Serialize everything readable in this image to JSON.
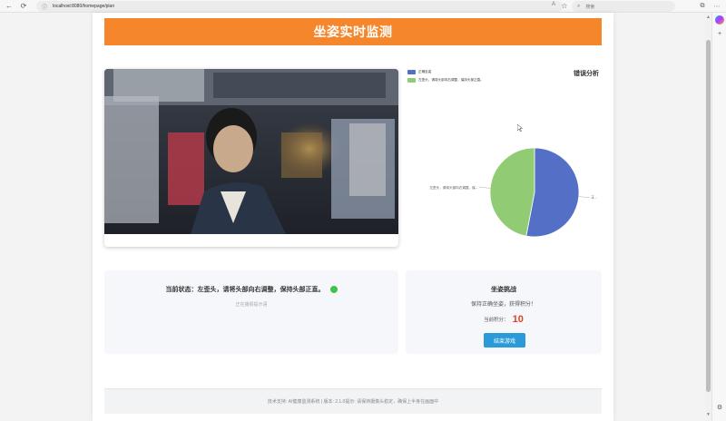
{
  "browser": {
    "url": "localhost:8080/homepage/plan",
    "search_placeholder": "搜索",
    "icons": [
      "back-icon",
      "refresh-icon",
      "info-icon",
      "read-aloud-icon",
      "favorite-icon",
      "search-icon",
      "extensions-icon",
      "more-icon",
      "copilot-icon",
      "add-icon",
      "settings-icon"
    ]
  },
  "header": {
    "title": "坐姿实时监测"
  },
  "chart": {
    "title": "错误分析",
    "chart_data": {
      "type": "pie",
      "title": "错误分析",
      "legend_position": "top-left",
      "series": [
        {
          "name": "正确坐姿",
          "value": 53,
          "color": "#5470c6"
        },
        {
          "name": "左歪头，请将头部向右调整，保持头部正直。",
          "value": 47,
          "color": "#91cc75"
        }
      ],
      "labels": [
        {
          "text": "正...",
          "side": "right"
        },
        {
          "text": "左歪头，请将头部向右调整，保...",
          "side": "left"
        }
      ]
    }
  },
  "status": {
    "label": "当前状态：左歪头，请将头部向右调整，保持头部正直。",
    "sub": "正在播报提示语",
    "dot_color": "#3dc24b"
  },
  "game": {
    "title": "坐姿挑战",
    "hint": "保持正确坐姿，获得积分！",
    "score_label": "当前积分：",
    "score_value": "10",
    "end_button": "结束游戏"
  },
  "footer": {
    "text": "技术支持: AI健康监测系统 | 版本: 2.1.0提示: 请保持摄像头稳定，确保上半身在画面中"
  }
}
